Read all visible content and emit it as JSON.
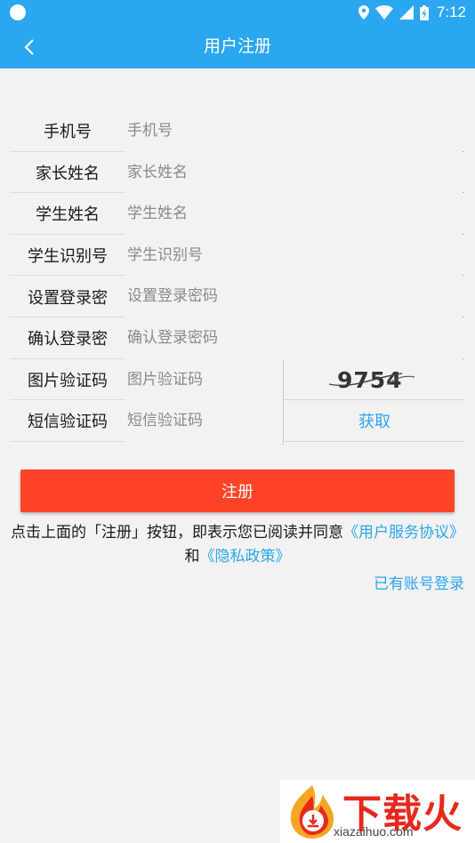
{
  "status_bar": {
    "time": "7:12"
  },
  "app_bar": {
    "title": "用户注册"
  },
  "form": {
    "rows": [
      {
        "label": "手机号",
        "placeholder": "手机号"
      },
      {
        "label": "家长姓名",
        "placeholder": "家长姓名"
      },
      {
        "label": "学生姓名",
        "placeholder": "学生姓名"
      },
      {
        "label": "学生识别号",
        "placeholder": "学生识别号"
      },
      {
        "label": "设置登录密",
        "placeholder": "设置登录密码"
      },
      {
        "label": "确认登录密",
        "placeholder": "确认登录密码"
      },
      {
        "label": "图片验证码",
        "placeholder": "图片验证码"
      },
      {
        "label": "短信验证码",
        "placeholder": "短信验证码"
      }
    ],
    "captcha_text": "9754",
    "get_code_label": "获取"
  },
  "submit_label": "注册",
  "agreement": {
    "prefix": "点击上面的「注册」按钮，即表示您已阅读并同意",
    "user_agreement": "《用户服务协议》",
    "conjunction": "和",
    "privacy_policy": "《隐私政策》"
  },
  "login_link": "已有账号登录",
  "watermark": {
    "brand": "下载火",
    "url": "xiazaihuo.com"
  },
  "colors": {
    "primary": "#2ba6f0",
    "submit": "#ff4326",
    "background": "#f2f2f2"
  }
}
